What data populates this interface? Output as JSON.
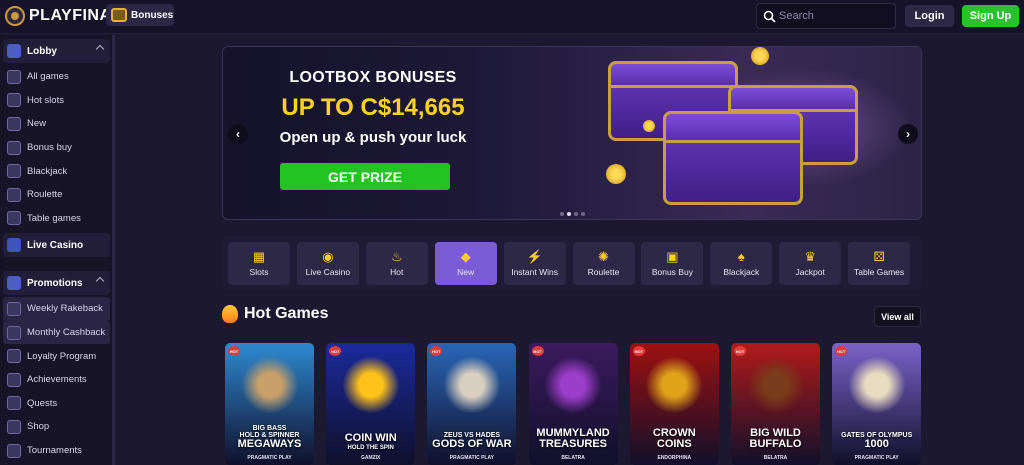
{
  "header": {
    "brand": "PLAYFINA",
    "bonuses_label": "Bonuses",
    "search_placeholder": "Search",
    "login_label": "Login",
    "signup_label": "Sign Up"
  },
  "sidebar": {
    "lobby_label": "Lobby",
    "lobby_items": [
      {
        "label": "All games",
        "icon": "grid-icon"
      },
      {
        "label": "Hot slots",
        "icon": "flame-icon"
      },
      {
        "label": "New",
        "icon": "diamond-icon"
      },
      {
        "label": "Bonus buy",
        "icon": "gift-icon"
      },
      {
        "label": "Blackjack",
        "icon": "cards-icon"
      },
      {
        "label": "Roulette",
        "icon": "roulette-icon"
      },
      {
        "label": "Table games",
        "icon": "dice-icon"
      }
    ],
    "live_casino_label": "Live Casino",
    "promotions_label": "Promotions",
    "promo_items": [
      {
        "label": "Weekly Rakeback",
        "icon": "percent-icon"
      },
      {
        "label": "Monthly Cashback",
        "icon": "cashback-icon"
      },
      {
        "label": "Loyalty Program",
        "icon": "star-icon"
      },
      {
        "label": "Achievements",
        "icon": "gear-icon"
      },
      {
        "label": "Quests",
        "icon": "compass-icon"
      },
      {
        "label": "Shop",
        "icon": "cart-icon"
      },
      {
        "label": "Tournaments",
        "icon": "trophy-icon"
      }
    ]
  },
  "banner": {
    "title": "LOOTBOX BONUSES",
    "amount": "UP TO C$14,665",
    "subtitle": "Open up & push your luck",
    "cta": "GET PRIZE",
    "prev_icon": "chevron-left-icon",
    "next_icon": "chevron-right-icon",
    "slide_count": 4,
    "active_slide": 2
  },
  "categories": [
    {
      "label": "Slots",
      "icon": "slots-icon",
      "glyph": "▦"
    },
    {
      "label": "Live Casino",
      "icon": "live-icon",
      "glyph": "◉"
    },
    {
      "label": "Hot",
      "icon": "flame-icon",
      "glyph": "♨"
    },
    {
      "label": "New",
      "icon": "diamond-icon",
      "glyph": "◆",
      "selected": true
    },
    {
      "label": "Instant Wins",
      "icon": "bolt-icon",
      "glyph": "⚡"
    },
    {
      "label": "Roulette",
      "icon": "roulette-icon",
      "glyph": "✺"
    },
    {
      "label": "Bonus Buy",
      "icon": "gift-icon",
      "glyph": "▣"
    },
    {
      "label": "Blackjack",
      "icon": "cards-icon",
      "glyph": "♠"
    },
    {
      "label": "Jackpot",
      "icon": "jackpot-icon",
      "glyph": "♛"
    },
    {
      "label": "Table Games",
      "icon": "dice-icon",
      "glyph": "⚄"
    }
  ],
  "hot_games": {
    "title": "Hot Games",
    "view_all": "View all",
    "badge": "HOT",
    "games": [
      {
        "name_lines": [
          "BIG BASS",
          "HOLD & SPINNER",
          "MEGAWAYS"
        ],
        "provider": "PRAGMATIC PLAY",
        "bg": "#2f8ad0",
        "art": "#c8a06a"
      },
      {
        "name_lines": [
          "COIN WIN",
          "HOLD THE SPIN"
        ],
        "provider": "GAMZIX",
        "bg": "#1a2a9a",
        "art": "#ffc21a"
      },
      {
        "name_lines": [
          "ZEUS VS HADES",
          "GODS OF WAR"
        ],
        "provider": "PRAGMATIC PLAY",
        "bg": "#2a67b8",
        "art": "#d8cfc0"
      },
      {
        "name_lines": [
          "MUMMYLAND",
          "TREASURES"
        ],
        "provider": "BELATRA",
        "bg": "#3b1a5e",
        "art": "#9b3ec9"
      },
      {
        "name_lines": [
          "CROWN",
          "COINS"
        ],
        "provider": "ENDORPHINA",
        "bg": "#9e1111",
        "art": "#e0a21a"
      },
      {
        "name_lines": [
          "BIG WILD",
          "BUFFALO"
        ],
        "provider": "BELATRA",
        "bg": "#b11a1a",
        "art": "#7a3b1a"
      },
      {
        "name_lines": [
          "GATES OF OLYMPUS",
          "1000"
        ],
        "provider": "PRAGMATIC PLAY",
        "bg": "#7a63c8",
        "art": "#e8dcc0"
      }
    ]
  }
}
